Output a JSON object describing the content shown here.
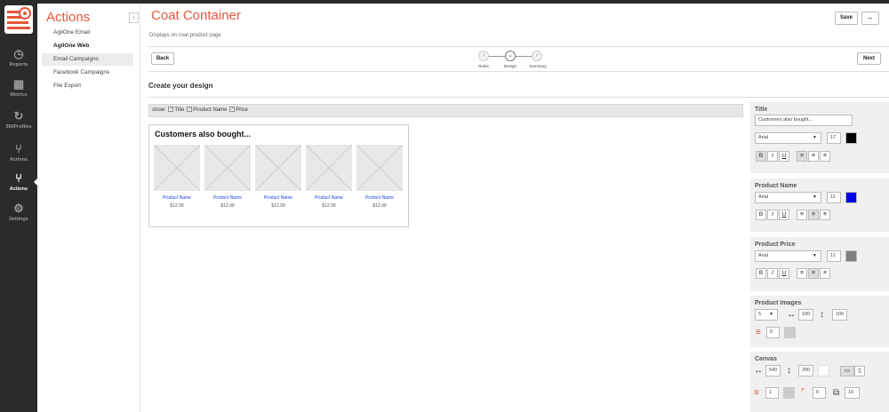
{
  "nav_rail": {
    "items": [
      {
        "label": "Reports",
        "icon": "clock-icon"
      },
      {
        "label": "Metrics",
        "icon": "grid-icon"
      },
      {
        "label": "360Profiles",
        "icon": "refresh-icon"
      },
      {
        "label": "Actions",
        "icon": "branch-icon"
      },
      {
        "label": "Actions",
        "icon": "branch-check-icon"
      },
      {
        "label": "Settings",
        "icon": "gears-icon"
      }
    ],
    "active_index": 4
  },
  "subnav": {
    "title": "Actions",
    "collapse_glyph": "‹",
    "items": [
      "AgilOne Email",
      "AgilOne Web",
      "Email Campaigns",
      "Facebook Campaigns",
      "File Export"
    ]
  },
  "header": {
    "title": "Coat Container",
    "subtitle": "Displays on coat product page",
    "save_label": "Save",
    "more_label": "..."
  },
  "wizard": {
    "back_label": "Back",
    "next_label": "Next",
    "steps": [
      "Rules",
      "Design",
      "Summary"
    ],
    "current_step": 1
  },
  "design": {
    "section_title": "Create your design",
    "show_label": "show:",
    "show_options": [
      "Title",
      "Product Name",
      "Price"
    ],
    "widget_title": "Customers also bought...",
    "products": [
      {
        "name": "Product Name",
        "price": "$12.99"
      },
      {
        "name": "Product Name",
        "price": "$12.99"
      },
      {
        "name": "Product Name",
        "price": "$12.99"
      },
      {
        "name": "Product Name",
        "price": "$12.99"
      },
      {
        "name": "Product Name",
        "price": "$12.99"
      }
    ]
  },
  "settings": {
    "title_panel": {
      "heading": "Title",
      "value": "Customers also bought...",
      "font": "Arial",
      "size": "17",
      "color": "#000000"
    },
    "product_name_panel": {
      "heading": "Product Name",
      "font": "Arial",
      "size": "11",
      "color": "#0000ee"
    },
    "product_price_panel": {
      "heading": "Product Price",
      "font": "Arial",
      "size": "11",
      "color": "#808080"
    },
    "product_images_panel": {
      "heading": "Product Images",
      "count": "5",
      "width": "100",
      "height": "100",
      "border": "0",
      "border_color": "#cccccc"
    },
    "canvas_panel": {
      "heading": "Canvas",
      "width": "540",
      "height": "200",
      "bg_color": "#ffffff",
      "border": "1",
      "border_color": "#cccccc",
      "radius": "0",
      "padding": "10"
    },
    "format_labels": {
      "bold": "B",
      "italic": "I",
      "underline": "U"
    }
  },
  "colors": {
    "accent": "#e4573d",
    "link": "#1a3ee0",
    "rail": "#2b2b2b"
  }
}
